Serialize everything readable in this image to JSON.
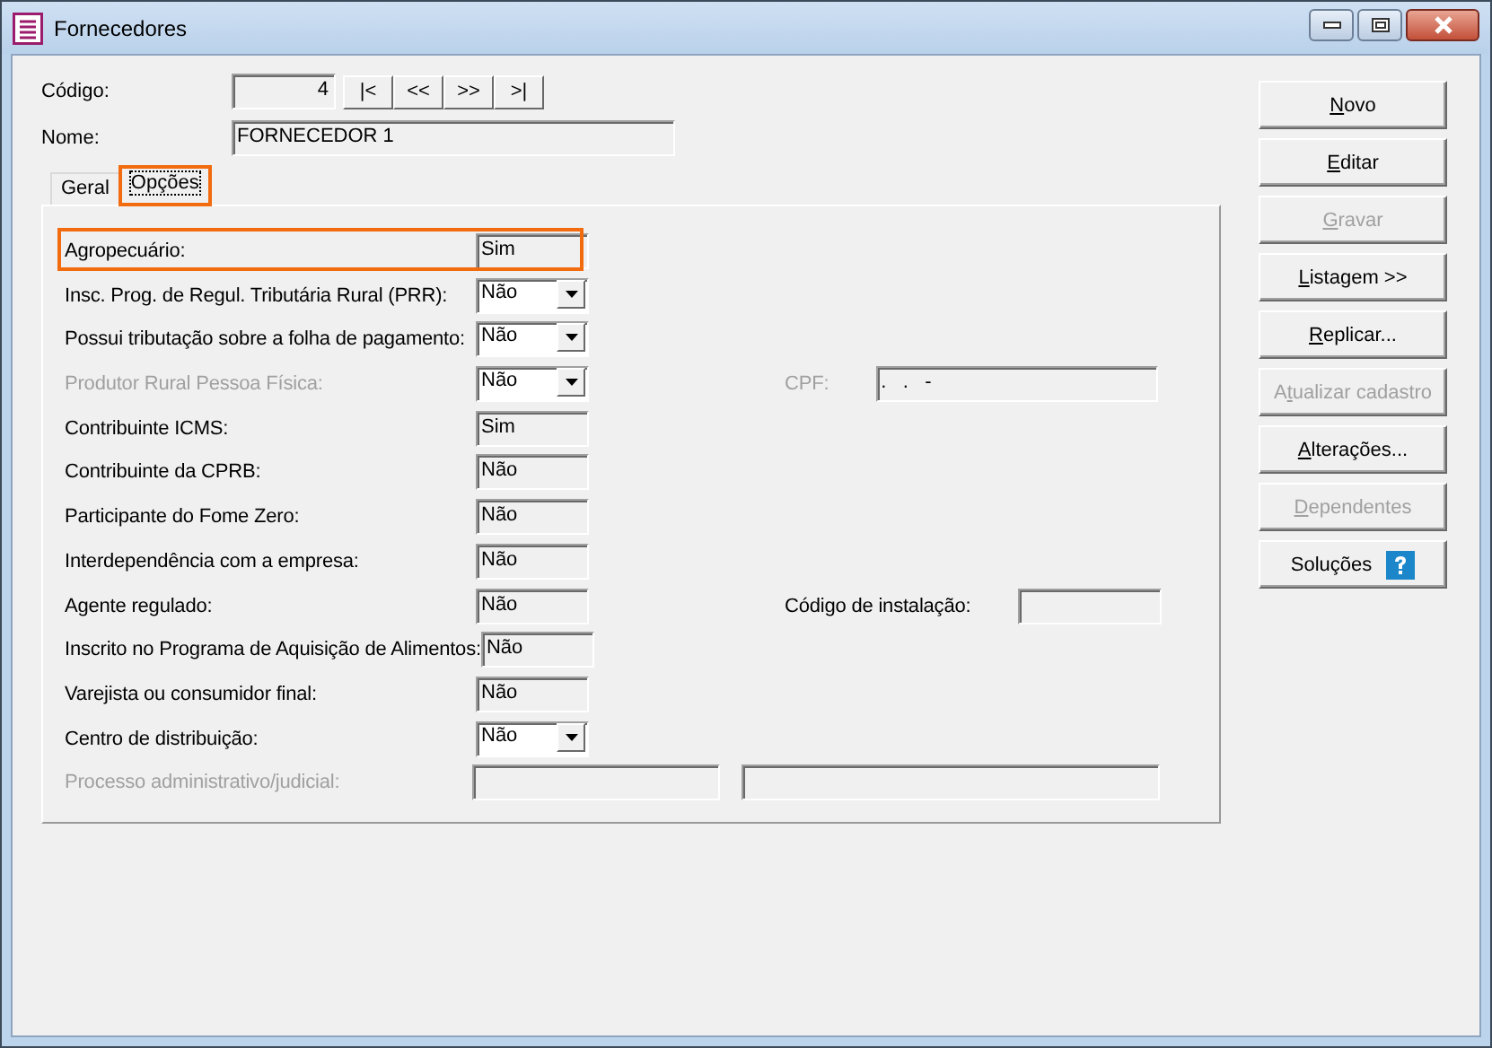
{
  "window": {
    "title": "Fornecedores"
  },
  "header": {
    "code_label": "Código:",
    "code_value": "4",
    "nav_buttons": [
      "|<",
      "<<",
      ">>",
      ">|"
    ],
    "name_label": "Nome:",
    "name_value": "FORNECEDOR 1"
  },
  "tabs": [
    {
      "label": "Geral",
      "selected": false,
      "highlighted": false
    },
    {
      "label": "Opções",
      "selected": true,
      "highlighted": true
    }
  ],
  "rows": [
    {
      "kind": "text",
      "label": "Agropecuário:",
      "value": "Sim",
      "disabled": false,
      "highlighted": true
    },
    {
      "kind": "combo",
      "label": "Insc. Prog. de Regul. Tributária Rural (PRR):",
      "value": "Não",
      "disabled": false,
      "highlighted": false
    },
    {
      "kind": "combo",
      "label": "Possui tributação sobre a folha de pagamento:",
      "value": "Não",
      "disabled": false,
      "highlighted": false
    },
    {
      "kind": "combo",
      "label": "Produtor Rural Pessoa Física:",
      "value": "Não",
      "disabled": true,
      "highlighted": false,
      "extra": {
        "label": "CPF:",
        "value": ".   .   -",
        "disabled": true
      }
    },
    {
      "kind": "text",
      "label": "Contribuinte ICMS:",
      "value": "Sim",
      "disabled": false,
      "highlighted": false
    },
    {
      "kind": "text",
      "label": "Contribuinte da CPRB:",
      "value": "Não",
      "disabled": false,
      "highlighted": false
    },
    {
      "kind": "text",
      "label": "Participante do Fome Zero:",
      "value": "Não",
      "disabled": false,
      "highlighted": false
    },
    {
      "kind": "text",
      "label": "Interdependência com a empresa:",
      "value": "Não",
      "disabled": false,
      "highlighted": false
    },
    {
      "kind": "text",
      "label": "Agente regulado:",
      "value": "Não",
      "disabled": false,
      "highlighted": false,
      "extra": {
        "label": "Código de instalação:",
        "disabled": false
      }
    },
    {
      "kind": "text",
      "label": "Inscrito no Programa de Aquisição de Alimentos:",
      "value": "Não",
      "disabled": false,
      "highlighted": false
    },
    {
      "kind": "text",
      "label": "Varejista ou consumidor final:",
      "value": "Não",
      "disabled": false,
      "highlighted": false
    },
    {
      "kind": "combo",
      "label": "Centro de distribuição:",
      "value": "Não",
      "disabled": false,
      "highlighted": false
    },
    {
      "kind": "pair",
      "label": "Processo administrativo/judicial:",
      "disabled": true,
      "highlighted": false
    }
  ],
  "buttons": [
    {
      "label": "Novo",
      "disabled": false
    },
    {
      "label": "Editar",
      "disabled": false
    },
    {
      "label": "Gravar",
      "disabled": true
    },
    {
      "label": "Listagem >>",
      "disabled": false
    },
    {
      "label": "Replicar...",
      "disabled": false
    },
    {
      "label": "Atualizar cadastro",
      "disabled": true
    },
    {
      "label": "Alterações...",
      "disabled": false
    },
    {
      "label": "Dependentes",
      "disabled": true
    },
    {
      "label": "Soluções",
      "disabled": false,
      "help_icon": true
    }
  ]
}
